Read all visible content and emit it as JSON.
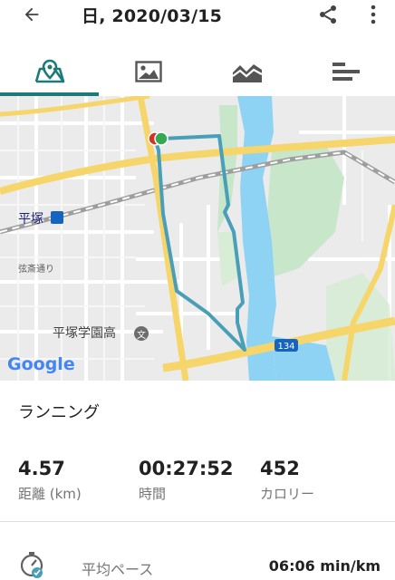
{
  "appbar": {
    "title": "日, 2020/03/15",
    "back_icon": "arrow-back-icon",
    "share_icon": "share-icon",
    "more_icon": "more-vert-icon"
  },
  "tabs": [
    {
      "icon": "map-icon",
      "active": true
    },
    {
      "icon": "image-icon",
      "active": false
    },
    {
      "icon": "chart-icon",
      "active": false
    },
    {
      "icon": "list-icon",
      "active": false
    }
  ],
  "map": {
    "labels": {
      "station": "平塚",
      "road": "弦斎通り",
      "school": "平塚学園高",
      "school_marker": "文",
      "route_no": "134",
      "logo": "Google"
    },
    "route_color": "#4a9fb8",
    "start_color": "#34a853",
    "end_color": "#d93025"
  },
  "summary": {
    "activity": "ランニング",
    "stats": [
      {
        "value": "4.57",
        "label": "距離 (km)"
      },
      {
        "value": "00:27:52",
        "label": "時間"
      },
      {
        "value": "452",
        "label": "カロリー"
      }
    ],
    "pace": {
      "label": "平均ペース",
      "value": "06:06 min/km"
    }
  },
  "colors": {
    "accent": "#1c7a79",
    "river": "#8fd3f4",
    "park": "#c8e6c9",
    "road_major": "#f6d66b"
  }
}
